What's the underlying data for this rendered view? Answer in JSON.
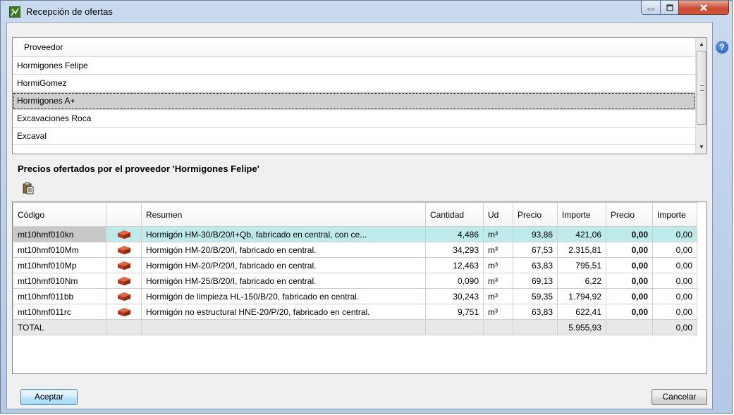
{
  "window": {
    "title": "Recepción de ofertas"
  },
  "supplier_list": {
    "header": "Proveedor",
    "items": [
      {
        "label": "Hormigones Felipe"
      },
      {
        "label": "HormiGomez"
      },
      {
        "label": "Hormigones A+",
        "selected": true
      },
      {
        "label": "Excavaciones Roca"
      },
      {
        "label": "Excaval"
      }
    ]
  },
  "offers": {
    "title": "Precios ofertados por el proveedor 'Hormigones Felipe'",
    "columns": [
      "Código",
      "",
      "Resumen",
      "Cantidad",
      "Ud",
      "Precio",
      "Importe",
      "Precio",
      "Importe"
    ],
    "rows": [
      {
        "code": "mt10hmf010kn",
        "summary": "Hormigón HM-30/B/20/I+Qb, fabricado en central, con ce...",
        "qty": "4,486",
        "unit": "m³",
        "price": "93,86",
        "amount": "421,06",
        "offer_price": "0,00",
        "offer_amount": "0,00"
      },
      {
        "code": "mt10hmf010Mm",
        "summary": "Hormigón HM-20/B/20/I, fabricado en central.",
        "qty": "34,293",
        "unit": "m³",
        "price": "67,53",
        "amount": "2.315,81",
        "offer_price": "0,00",
        "offer_amount": "0,00"
      },
      {
        "code": "mt10hmf010Mp",
        "summary": "Hormigón HM-20/P/20/I, fabricado en central.",
        "qty": "12,463",
        "unit": "m³",
        "price": "63,83",
        "amount": "795,51",
        "offer_price": "0,00",
        "offer_amount": "0,00"
      },
      {
        "code": "mt10hmf010Nm",
        "summary": "Hormigón HM-25/B/20/I, fabricado en central.",
        "qty": "0,090",
        "unit": "m³",
        "price": "69,13",
        "amount": "6,22",
        "offer_price": "0,00",
        "offer_amount": "0,00"
      },
      {
        "code": "mt10hmf011bb",
        "summary": "Hormigón de limpieza HL-150/B/20, fabricado en central.",
        "qty": "30,243",
        "unit": "m³",
        "price": "59,35",
        "amount": "1.794,92",
        "offer_price": "0,00",
        "offer_amount": "0,00"
      },
      {
        "code": "mt10hmf011rc",
        "summary": "Hormigón no estructural HNE-20/P/20, fabricado en central.",
        "qty": "9,751",
        "unit": "m³",
        "price": "63,83",
        "amount": "622,41",
        "offer_price": "0,00",
        "offer_amount": "0,00"
      }
    ],
    "total": {
      "label": "TOTAL",
      "amount": "5.955,93",
      "offer_amount": "0,00"
    }
  },
  "buttons": {
    "accept": "Aceptar",
    "cancel": "Cancelar"
  },
  "help_glyph": "?",
  "colors": {
    "highlight_row": "#bfeaea",
    "selected_supplier": "#cfcfcf",
    "close_button": "#c74a32",
    "brick": "#c0392b"
  },
  "icons": [
    "app-icon",
    "minimize-icon",
    "maximize-icon",
    "close-icon",
    "help-icon",
    "paste-icon",
    "brick-icon"
  ]
}
